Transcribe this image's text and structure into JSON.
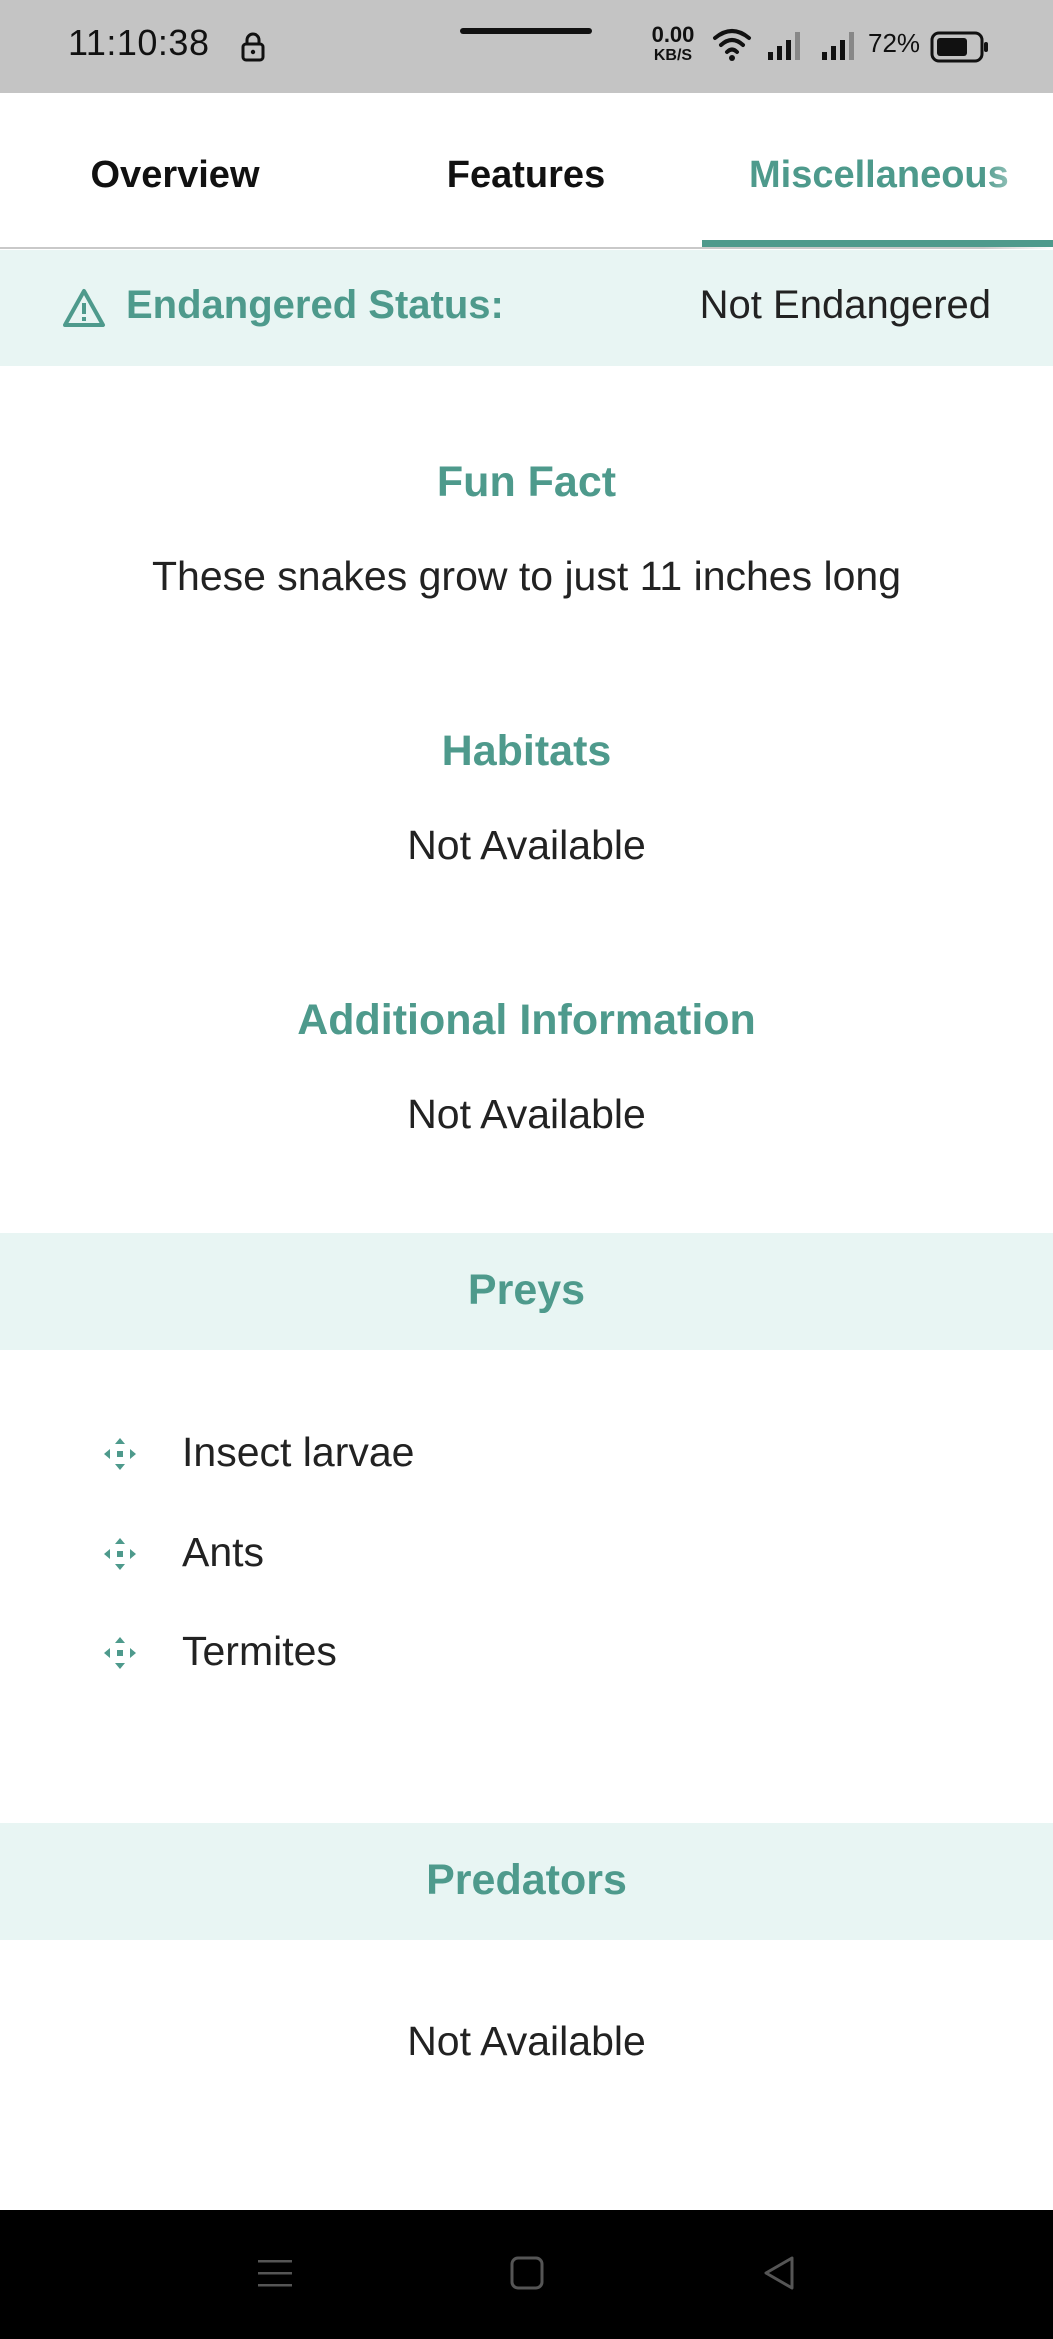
{
  "status_bar": {
    "time": "11:10:38",
    "net_speed_value": "0.00",
    "net_speed_unit": "KB/S",
    "battery_percent": "72%",
    "icons": [
      "lock-icon",
      "wifi-icon",
      "signal-icon",
      "signal-icon",
      "battery-icon"
    ]
  },
  "tabs": {
    "overview": "Overview",
    "features": "Features",
    "misc": "Miscellaneous",
    "selected": "Miscellaneous"
  },
  "endangered": {
    "label": "Endangered Status:",
    "value": "Not Endangered",
    "icon": "warning-icon"
  },
  "fun_fact": {
    "title": "Fun Fact",
    "text": "These snakes grow to just 11 inches long"
  },
  "habitats": {
    "title": "Habitats",
    "text": "Not Available"
  },
  "additional_info": {
    "title": "Additional Information",
    "text": "Not Available"
  },
  "preys": {
    "title": "Preys",
    "items": [
      {
        "label": "Insect larvae"
      },
      {
        "label": "Ants"
      },
      {
        "label": "Termites"
      }
    ],
    "icon": "move-arrows-icon"
  },
  "predators": {
    "title": "Predators",
    "text": "Not Available"
  },
  "nav_bar": {
    "icons": [
      "menu-icon",
      "home-icon",
      "back-icon"
    ]
  },
  "colors": {
    "accent": "#4e9a8c",
    "band": "#e8f5f3",
    "status_bar": "#c4c4c4"
  }
}
